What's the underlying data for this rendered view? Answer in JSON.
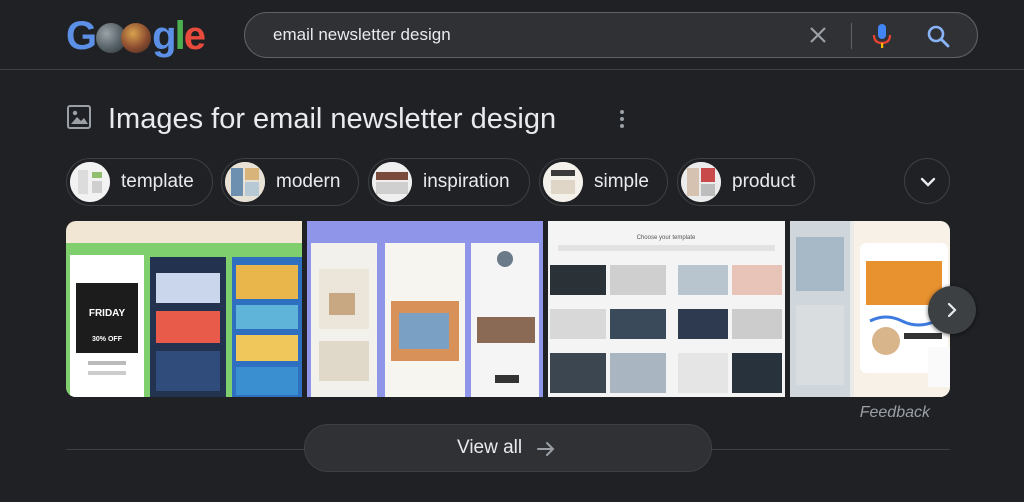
{
  "header": {
    "search_query": "email newsletter design"
  },
  "images_section": {
    "title": "Images for email newsletter design",
    "chips": [
      {
        "label": "template"
      },
      {
        "label": "modern"
      },
      {
        "label": "inspiration"
      },
      {
        "label": "simple"
      },
      {
        "label": "product"
      }
    ],
    "thumbnail_texts": {
      "friday": "FRIDAY",
      "off": "30% OFF",
      "choose_template": "Choose your template"
    },
    "feedback_label": "Feedback",
    "view_all_label": "View all"
  },
  "colors": {
    "background": "#202124",
    "search_bg": "#303134",
    "border": "#5f6368",
    "text": "#e8eaed",
    "muted_text": "#9aa0a6",
    "accent_blue": "#8ab4f8"
  },
  "icons": {
    "clear": "close-icon",
    "mic": "microphone-icon",
    "search": "search-icon",
    "image": "image-icon",
    "more": "more-vert-icon",
    "expand": "chevron-down-icon",
    "next": "chevron-right-icon",
    "arrow": "arrow-right-icon"
  }
}
